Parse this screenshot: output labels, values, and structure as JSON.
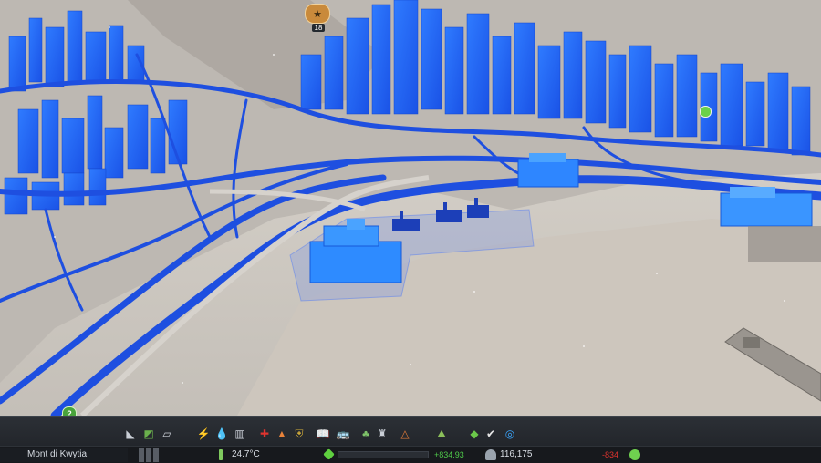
{
  "view": {
    "mode": "overlay",
    "overlay_color": "#1e5cff",
    "milestone_badge_text": "18"
  },
  "toolbar": {
    "tools": [
      {
        "name": "roads-icon",
        "glyph": "◣",
        "color": "#c9ced6"
      },
      {
        "name": "zoning-icon",
        "glyph": "◩",
        "color": "#6ab04c"
      },
      {
        "name": "districts-icon",
        "glyph": "▱",
        "color": "#c9ced6"
      },
      {
        "name": "electricity-icon",
        "glyph": "⚡",
        "color": "#4aa3ff"
      },
      {
        "name": "water-icon",
        "glyph": "💧",
        "color": "#3b8cff"
      },
      {
        "name": "garbage-icon",
        "glyph": "▥",
        "color": "#c9ced6"
      },
      {
        "name": "healthcare-icon",
        "glyph": "✚",
        "color": "#e0342f"
      },
      {
        "name": "fire-icon",
        "glyph": "▲",
        "color": "#e8823a"
      },
      {
        "name": "police-icon",
        "glyph": "⛨",
        "color": "#d9b23a"
      },
      {
        "name": "education-icon",
        "glyph": "📖",
        "color": "#e8e2d0"
      },
      {
        "name": "transport-icon",
        "glyph": "🚌",
        "color": "#f0c53c"
      },
      {
        "name": "beautification-icon",
        "glyph": "♣",
        "color": "#7ec26a"
      },
      {
        "name": "monuments-icon",
        "glyph": "♜",
        "color": "#c9ced6"
      },
      {
        "name": "wonders-icon",
        "glyph": "△",
        "color": "#e07b39"
      },
      {
        "name": "landscaping-icon",
        "glyph": "⛰",
        "color": "#8bbf5a"
      },
      {
        "name": "money-icon",
        "glyph": "◆",
        "color": "#6bc94a"
      },
      {
        "name": "policies-icon",
        "glyph": "✔",
        "color": "#e6e6e6"
      },
      {
        "name": "info-views-icon",
        "glyph": "◎",
        "color": "#3ba7ff"
      }
    ],
    "status": {
      "city_name": "Mont di Kwytia",
      "temperature": "24.7°C",
      "income": "+834.93",
      "population": "116,175",
      "expenses": "-834",
      "happiness_color": "#6fd14f"
    }
  }
}
